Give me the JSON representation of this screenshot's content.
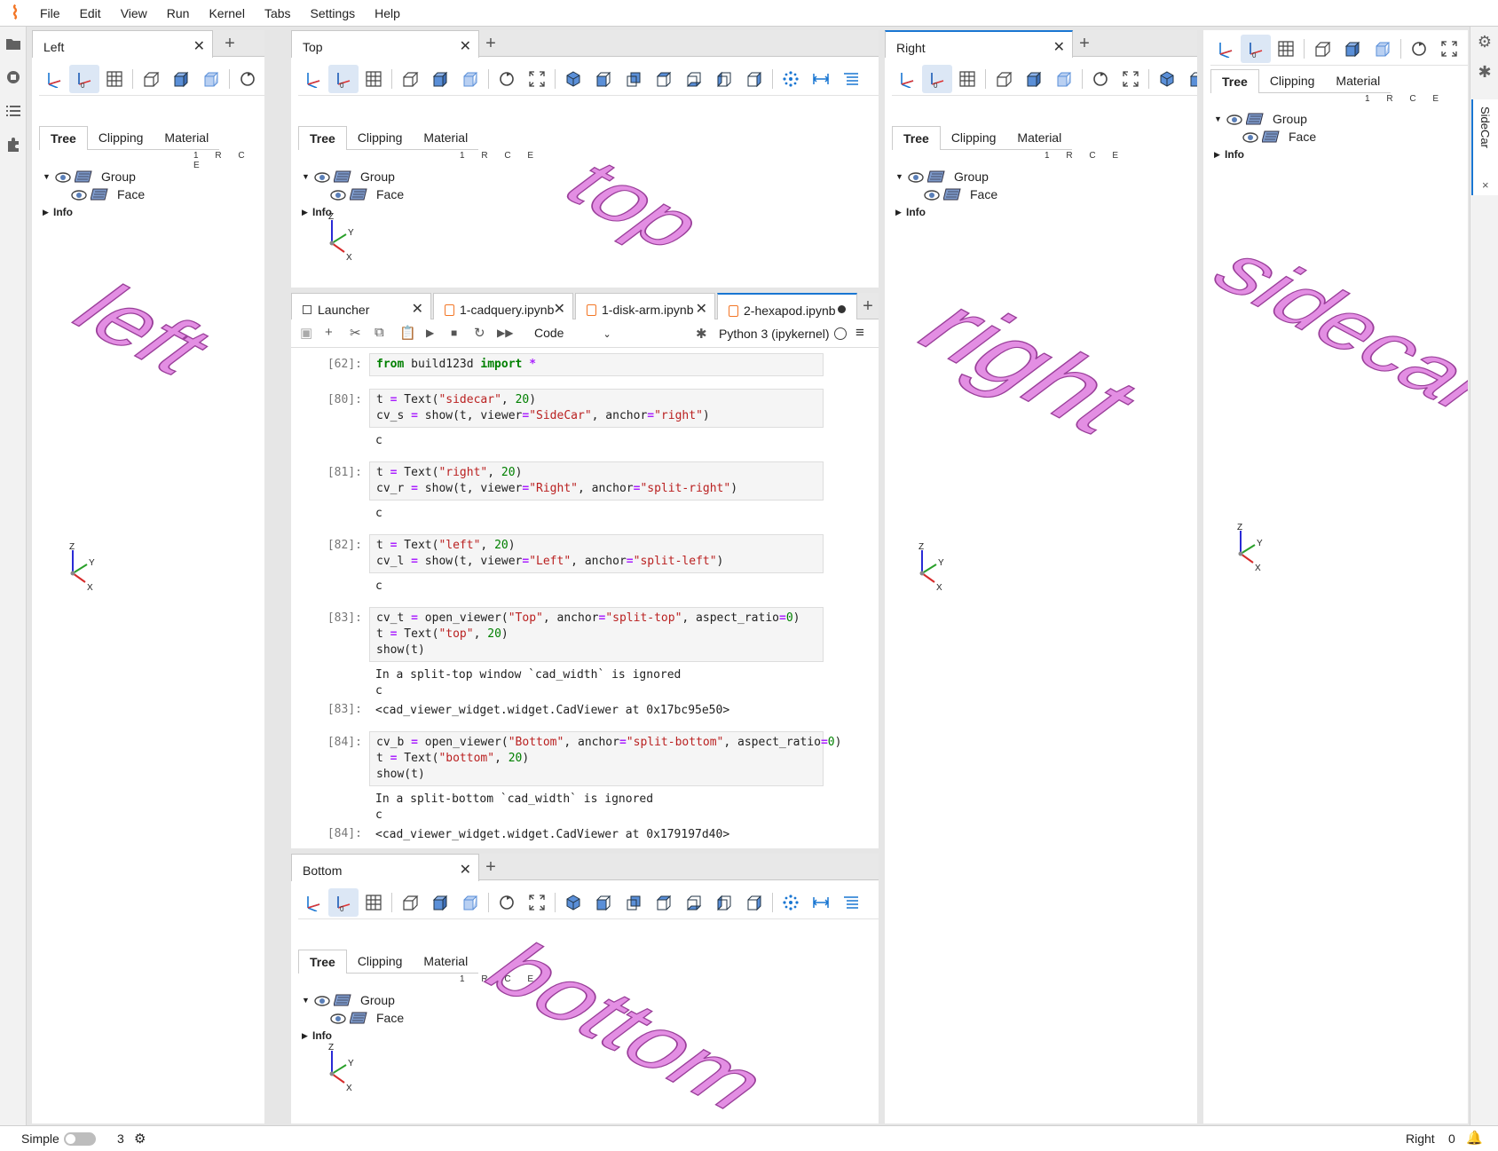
{
  "menubar": {
    "items": [
      "File",
      "Edit",
      "View",
      "Run",
      "Kernel",
      "Tabs",
      "Settings",
      "Help"
    ]
  },
  "status": {
    "mode_label": "Simple",
    "kernel_count": "3",
    "right_label": "Right",
    "right_count": "0"
  },
  "sidecar": {
    "tab_label": "SideCar",
    "close": "×",
    "text3d": "sidecar"
  },
  "viewer_tabs": {
    "tree": "Tree",
    "clipping": "Clipping",
    "material": "Material"
  },
  "rce": "1 R C E",
  "tree": {
    "group": "Group",
    "face": "Face",
    "info": "Info"
  },
  "axis": {
    "z": "Z",
    "y": "Y",
    "x": "X"
  },
  "panels": {
    "left": {
      "title": "Left",
      "text3d": "left"
    },
    "top": {
      "title": "Top",
      "text3d": "top"
    },
    "right": {
      "title": "Right",
      "text3d": "right"
    },
    "bottom": {
      "title": "Bottom",
      "text3d": "bottom"
    }
  },
  "notebook": {
    "tabs": [
      "Launcher",
      "1-cadquery.ipynb",
      "1-disk-arm.ipynb",
      "2-hexapod.ipynb"
    ],
    "cell_type": "Code",
    "kernel": "Python 3 (ipykernel)",
    "cells": [
      {
        "prompt": "[62]:",
        "lines": [
          "from build123d import *"
        ]
      },
      {
        "prompt": "[80]:",
        "lines": [
          "t = Text(\"sidecar\", 20)",
          "cv_s = show(t, viewer=\"SideCar\", anchor=\"right\")"
        ],
        "output": [
          "c"
        ]
      },
      {
        "prompt": "[81]:",
        "lines": [
          "t = Text(\"right\", 20)",
          "cv_r = show(t, viewer=\"Right\", anchor=\"split-right\")"
        ],
        "output": [
          "c"
        ]
      },
      {
        "prompt": "[82]:",
        "lines": [
          "t = Text(\"left\", 20)",
          "cv_l = show(t, viewer=\"Left\", anchor=\"split-left\")"
        ],
        "output": [
          "c"
        ]
      },
      {
        "prompt": "[83]:",
        "lines": [
          "cv_t = open_viewer(\"Top\", anchor=\"split-top\", aspect_ratio=0)",
          "t = Text(\"top\", 20)",
          "show(t)"
        ],
        "output": [
          "In a split-top window `cad_width` is ignored",
          "c"
        ],
        "result_prompt": "[83]:",
        "result": "<cad_viewer_widget.widget.CadViewer at 0x17bc95e50>"
      },
      {
        "prompt": "[84]:",
        "lines": [
          "cv_b = open_viewer(\"Bottom\", anchor=\"split-bottom\", aspect_ratio=0)",
          "t = Text(\"bottom\", 20)",
          "show(t)"
        ],
        "output": [
          "In a split-bottom `cad_width` is ignored",
          "c"
        ],
        "result_prompt": "[84]:",
        "result": "<cad_viewer_widget.widget.CadViewer at 0x179197d40>"
      }
    ]
  },
  "colors": {
    "accent": "#1976d2",
    "text3d_fill": "#e38ee3",
    "text3d_stroke": "#9a3f9a",
    "jupyter_orange": "#f37626"
  }
}
